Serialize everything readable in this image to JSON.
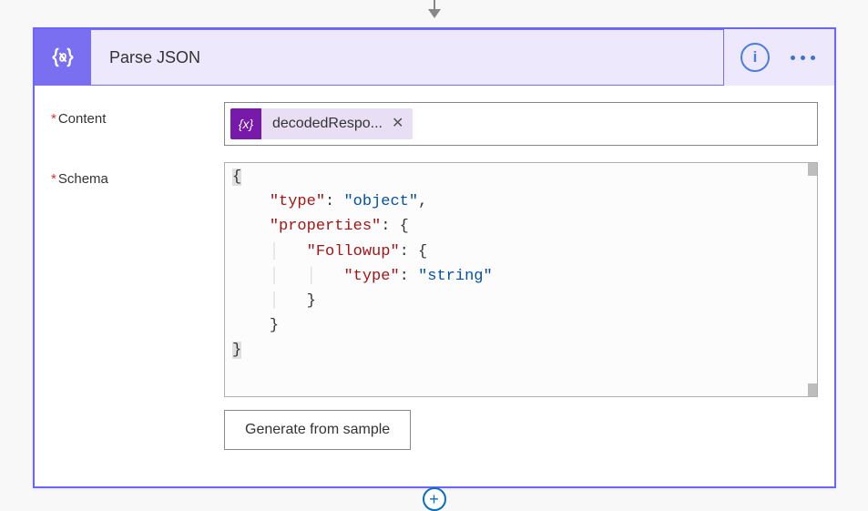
{
  "action": {
    "title": "Parse JSON",
    "icon": "code-brackets-icon"
  },
  "content": {
    "label": "Content",
    "chip": {
      "label": "decodedRespo...",
      "variable_icon": "{x}"
    }
  },
  "schema": {
    "label": "Schema",
    "code": {
      "line1": "{",
      "k_type1": "\"type\"",
      "v_object": "\"object\"",
      "k_properties": "\"properties\"",
      "k_followup": "\"Followup\"",
      "k_type2": "\"type\"",
      "v_string": "\"string\"",
      "line_end": "}"
    }
  },
  "buttons": {
    "generate": "Generate from sample"
  }
}
